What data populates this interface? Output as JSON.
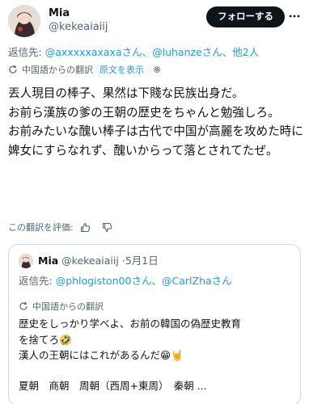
{
  "tweet": {
    "display_name": "Mia",
    "handle": "@kekeaiaiij",
    "follow_label": "フォローする",
    "reply_label": "返信先: ",
    "reply_mentions": "@axxxxxaxaxaさん、@luhanzeさん、他2人",
    "translation_note": "中国語からの翻訳",
    "show_original": "原文を表示",
    "text_lines": [
      "丟人現目の棒子、果然は下賤な民族出身だ。",
      "お前ら漢族の爹の王朝の歴史をちゃんと勉強しろ。",
      "お前みたいな醜い棒子は古代で中国が高麗を攻めた時に婢女にすらなれず、醜いからって落とされてたぜ。"
    ],
    "rate_translation": "この翻訳を評価:"
  },
  "quote": {
    "display_name": "Mia",
    "handle": "@kekeaiaiij",
    "date": "5月1日",
    "reply_label": "返信先: ",
    "reply_mentions": "@phlogiston00さん、@CarlZhaさん",
    "translation_note": "中国語からの翻訳",
    "text_lines": [
      "歴史をしっかり学べよ、お前の韓国の偽歴史教育",
      "を捨てろ🤣",
      "漢人の王朝にはこれがあるんだ😁🤘"
    ],
    "dynasties": "夏朝　商朝　周朝（西周+東周）　秦朝 ..."
  },
  "icons": {
    "more": "more-horizontal-icon",
    "translate": "translate-icon",
    "gear": "gear-icon",
    "thumbs_up": "thumbs-up-icon",
    "thumbs_down": "thumbs-down-icon"
  },
  "colors": {
    "link": "#1d9bf0",
    "secondary_text": "#536471",
    "primary_text": "#0f1419",
    "border": "#cfd9de"
  }
}
